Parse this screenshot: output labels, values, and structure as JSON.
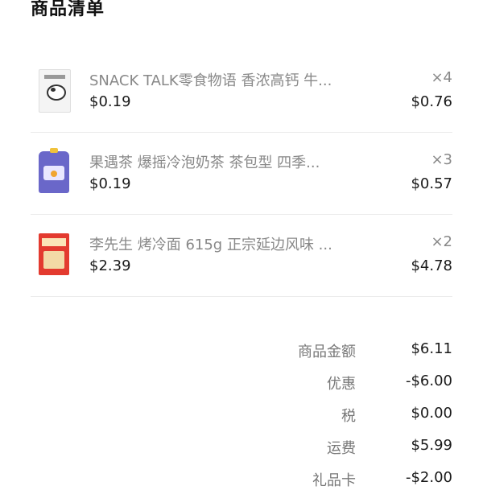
{
  "header": {
    "title": "商品清单"
  },
  "items": [
    {
      "name": "SNACK TALK零食物语 香浓高钙 牛...",
      "unit_price": "$0.19",
      "quantity": "×4",
      "total": "$0.76",
      "thumb_icon": "milk-powder-product-icon"
    },
    {
      "name": "果遇茶 爆摇冷泡奶茶 茶包型 四季...",
      "unit_price": "$0.19",
      "quantity": "×3",
      "total": "$0.57",
      "thumb_icon": "milk-tea-pouch-product-icon"
    },
    {
      "name": "李先生 烤冷面 615g 正宗延边风味 ...",
      "unit_price": "$2.39",
      "quantity": "×2",
      "total": "$4.78",
      "thumb_icon": "cold-noodle-product-icon"
    }
  ],
  "summary": [
    {
      "label": "商品金额",
      "value": "$6.11"
    },
    {
      "label": "优惠",
      "value": "-$6.00"
    },
    {
      "label": "税",
      "value": "$0.00"
    },
    {
      "label": "运费",
      "value": "$5.99"
    },
    {
      "label": "礼品卡",
      "value": "-$2.00"
    }
  ]
}
